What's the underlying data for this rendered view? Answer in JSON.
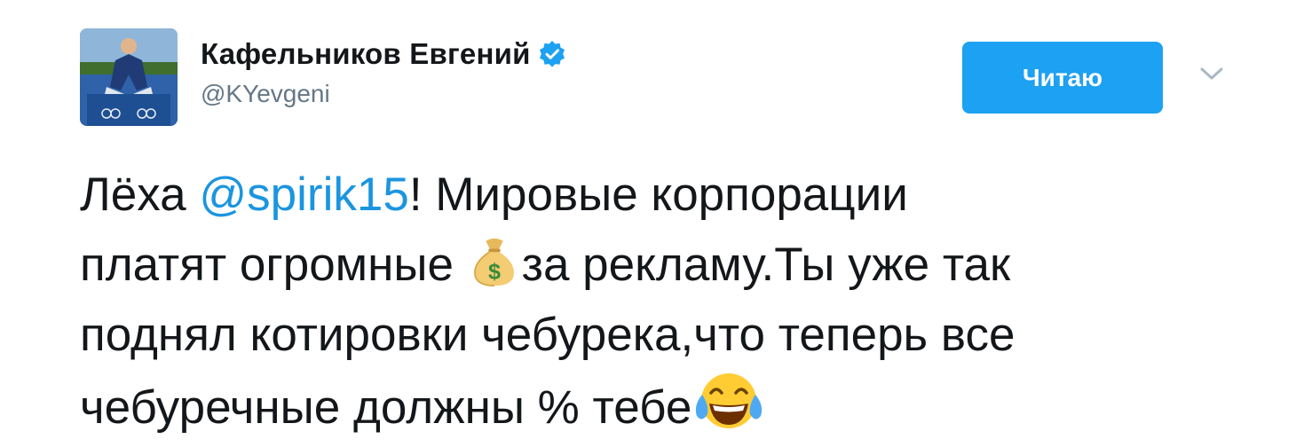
{
  "author": {
    "name": "Кафельников Евгений",
    "handle": "@KYevgeni",
    "verified": true,
    "avatar_icon": "avatar-photo"
  },
  "follow_button": {
    "label": "Читаю",
    "color": "#1da1f2"
  },
  "menu": {
    "icon": "chevron-down-icon"
  },
  "tweet": {
    "line1_before_mention": "Лёха ",
    "mention": "@spirik15",
    "line1_after_mention": "! Мировые корпорации",
    "line2_before_emoji": "платят огромные ",
    "line2_after_emoji": "за рекламу.Ты уже так",
    "line3": "поднял котировки чебурека,что теперь все",
    "line4": "чебуречные должны % тебе",
    "emojis": [
      "money-bag-emoji",
      "face-with-tears-of-joy-emoji"
    ]
  },
  "colors": {
    "text": "#14171a",
    "secondary": "#657786",
    "link": "#1b95e0",
    "verified": "#1da1f2"
  }
}
